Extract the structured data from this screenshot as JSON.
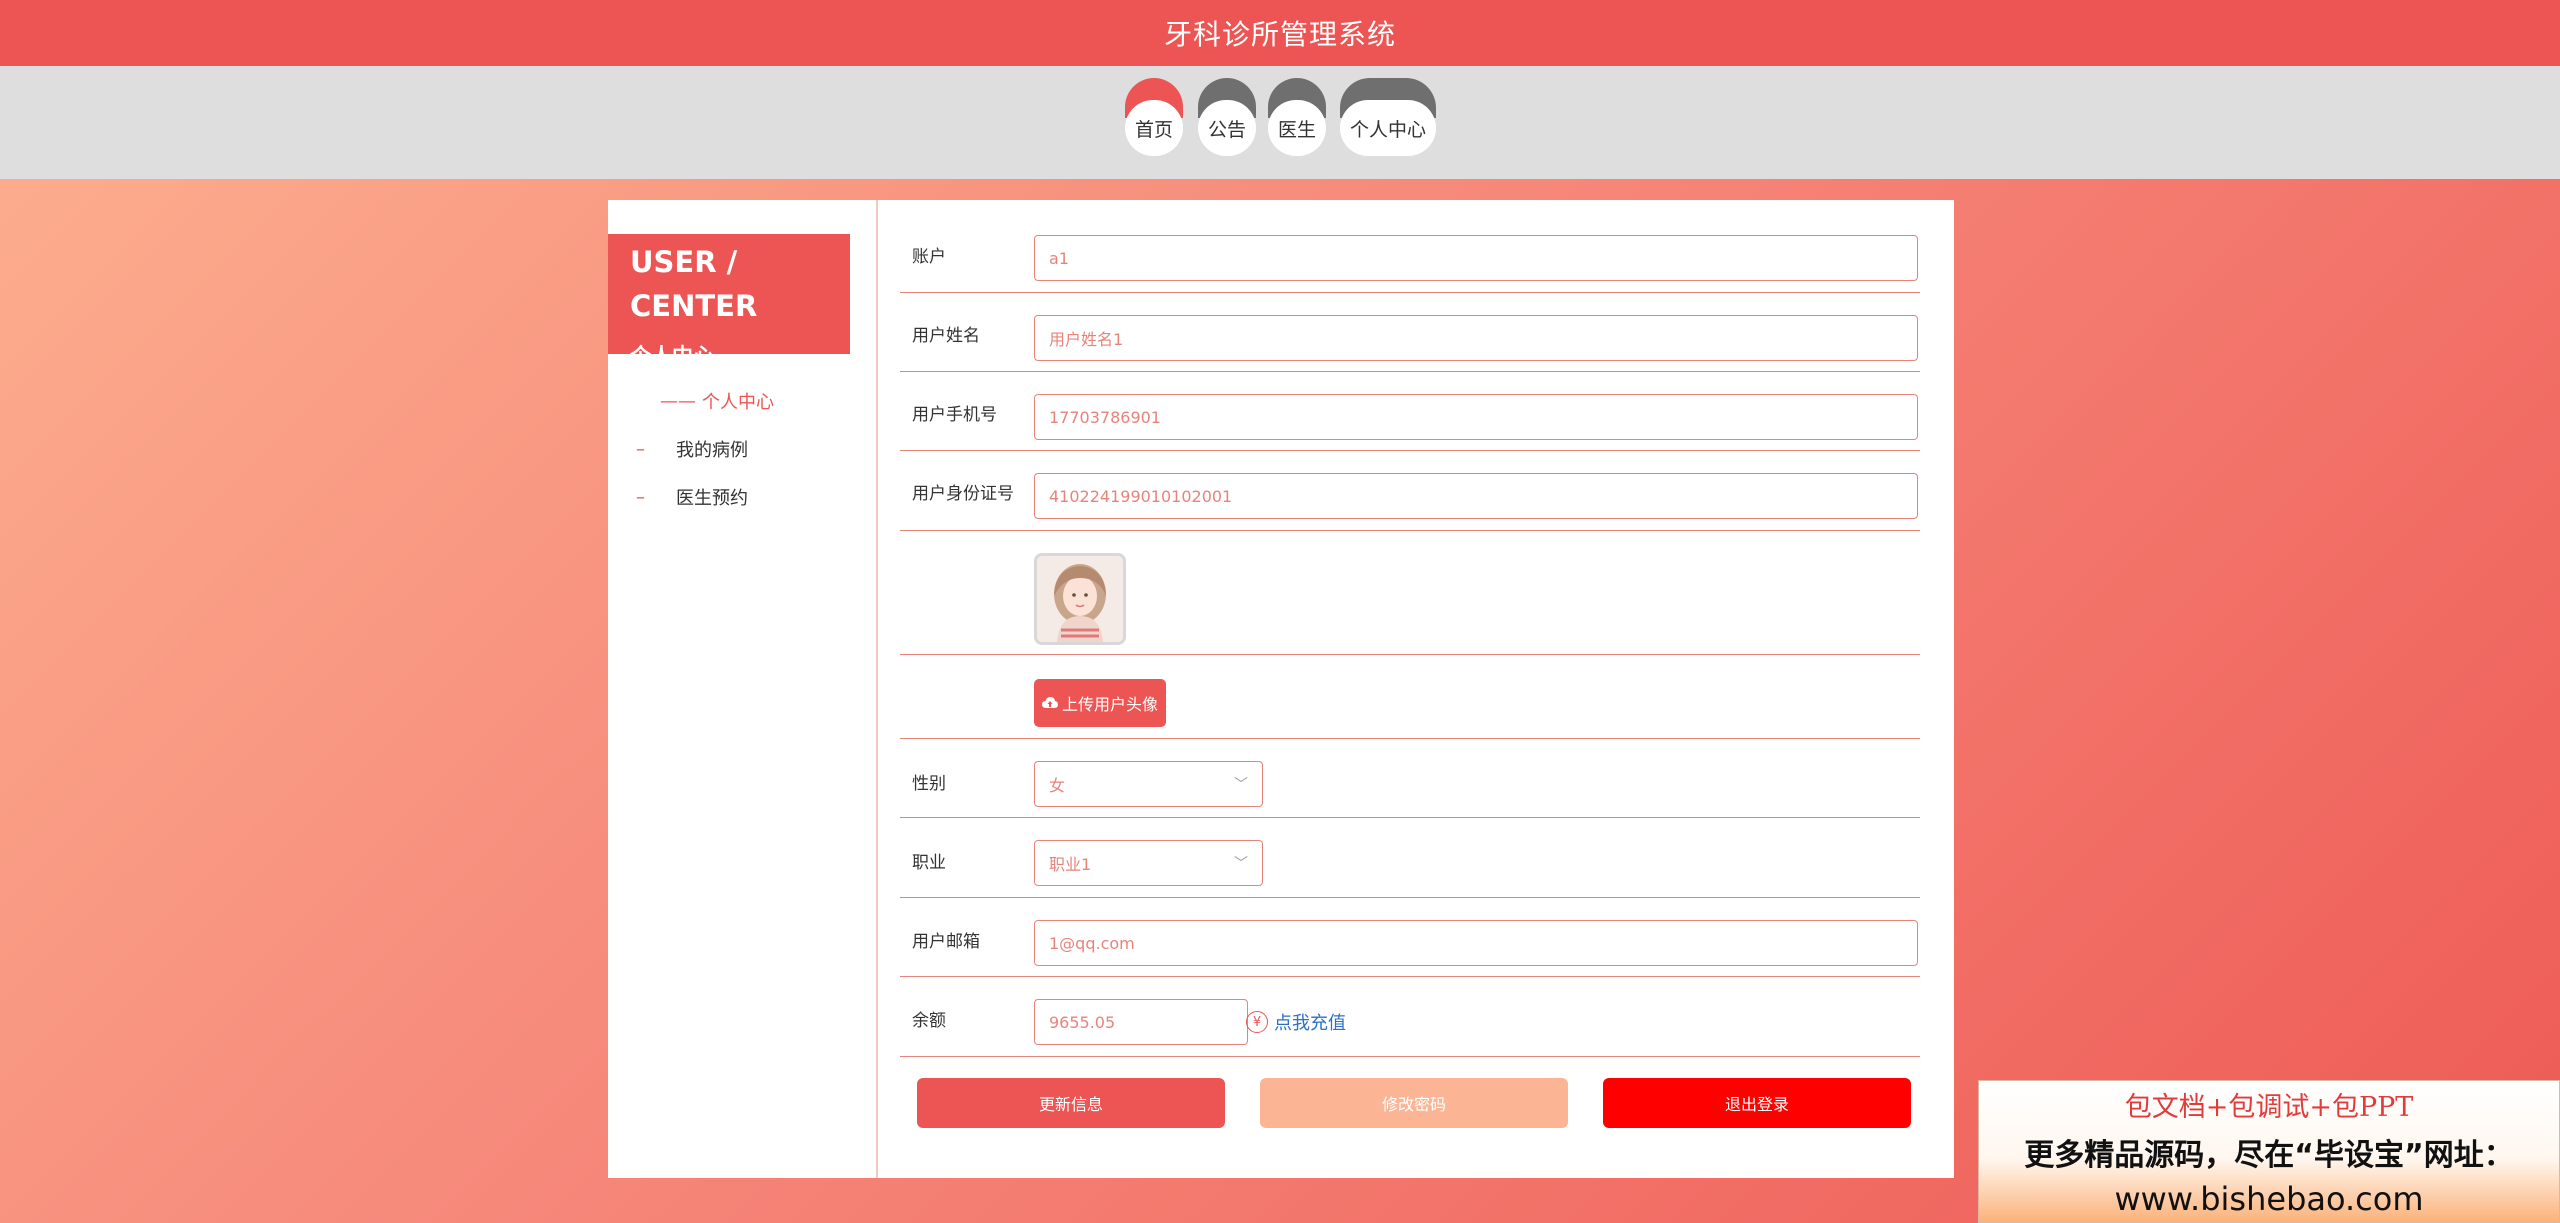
{
  "header": {
    "title": "牙科诊所管理系统"
  },
  "nav": [
    {
      "label": "首页",
      "active": true
    },
    {
      "label": "公告",
      "active": false
    },
    {
      "label": "医生",
      "active": false
    },
    {
      "label": "个人中心",
      "active": false
    }
  ],
  "sidebar": {
    "heading_en": "USER / CENTER",
    "heading_cn": "个人中心",
    "items": [
      {
        "label": "个人中心",
        "active": true
      },
      {
        "label": "我的病例",
        "active": false
      },
      {
        "label": "医生预约",
        "active": false
      }
    ]
  },
  "form": {
    "account": {
      "label": "账户",
      "value": "a1"
    },
    "name": {
      "label": "用户姓名",
      "value": "用户姓名1"
    },
    "phone": {
      "label": "用户手机号",
      "value": "17703786901"
    },
    "id_card": {
      "label": "用户身份证号",
      "value": "410224199010102001"
    },
    "avatar": {
      "icon": "user-avatar-photo"
    },
    "upload": {
      "label": "上传用户头像",
      "icon": "cloud-upload-icon"
    },
    "gender": {
      "label": "性别",
      "value": "女"
    },
    "job": {
      "label": "职业",
      "value": "职业1"
    },
    "email": {
      "label": "用户邮箱",
      "value": "1@qq.com"
    },
    "balance": {
      "label": "余额",
      "value": "9655.05",
      "recharge_label": "点我充值",
      "recharge_icon": "¥"
    }
  },
  "actions": {
    "update": "更新信息",
    "change_password": "修改密码",
    "logout": "退出登录"
  },
  "ad": {
    "line1": "包文档+包调试+包PPT",
    "line2": "更多精品源码，尽在“毕设宝”网址：",
    "line3": "www.bishebao.com"
  },
  "colors": {
    "primary": "#ec5553",
    "nav_inactive": "#6f6f6f",
    "field_border": "#e8837b",
    "link": "#2b71c4",
    "logout": "#ff0000",
    "password_btn": "#fcb594"
  }
}
